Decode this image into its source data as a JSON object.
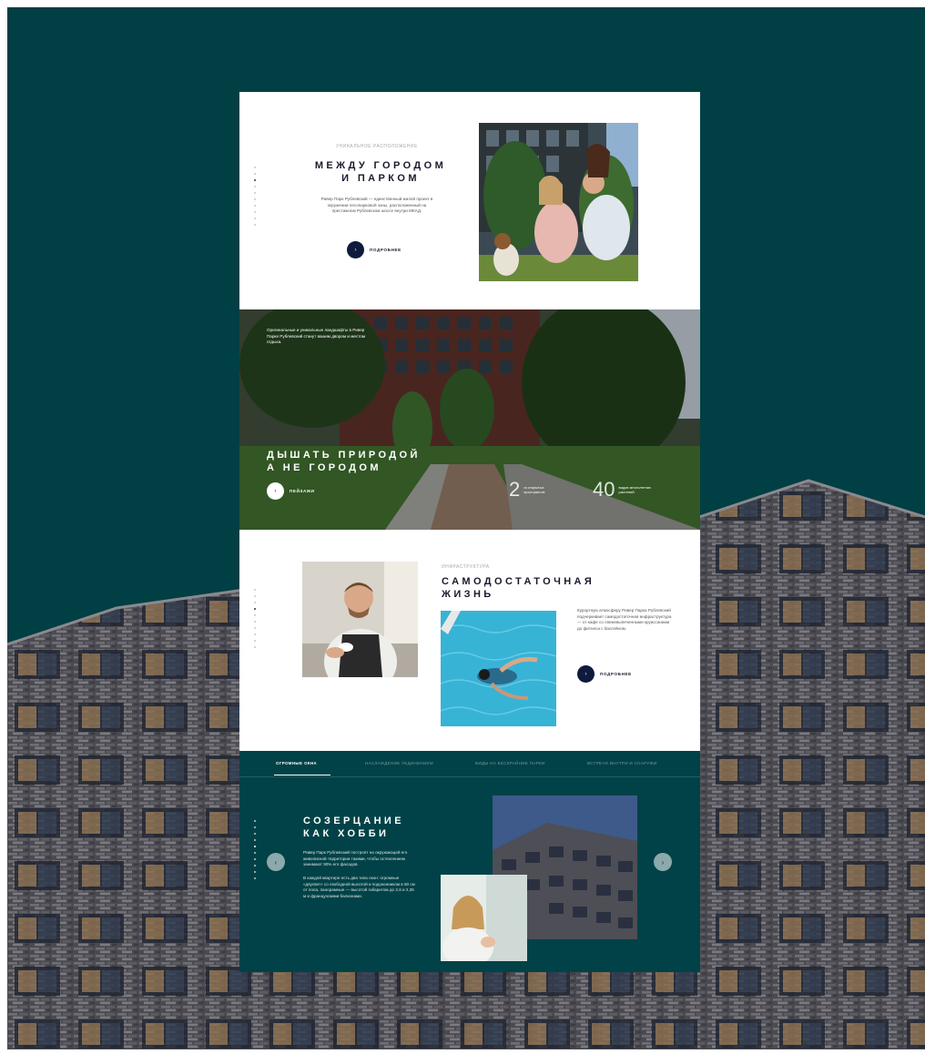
{
  "colors": {
    "teal": "#003f44",
    "navy": "#0f1b3d",
    "white": "#ffffff"
  },
  "section_location": {
    "eyebrow": "УНИКАЛЬНОЕ РАСПОЛОЖЕНИЕ",
    "title": "МЕЖДУ ГОРОДОМ\nИ ПАРКОМ",
    "text": "Ривер Парк Рублевский — единственный жилой проект в окружении лесопарковой зоны, расположенный на престижном Рублевском шоссе внутри МКАД.",
    "more_label": "ПОДРОБНЕЕ"
  },
  "section_nature": {
    "intro": "Оригинальные и уникальные ландшафты в Ривер Парке Рублевский станут вашим двором и местом отдыха.",
    "title": "ДЫШАТЬ ПРИРОДОЙ\nА НЕ ГОРОДОМ",
    "btn_label": "ПЕЙЗАЖИ",
    "stats": [
      {
        "num": "2",
        "label": "га открытых пространств"
      },
      {
        "num": "40",
        "label": "видов многолетних растений"
      }
    ]
  },
  "section_infra": {
    "eyebrow": "ИНФРАСТРУКТУРА",
    "title": "САМОДОСТАТОЧНАЯ\nЖИЗНЬ",
    "text": "Курортную атмосферу Ривер Парка Рублевский подчеркивает самодостаточная инфраструктура — от кафе со свежевыпеченными круассанами до фитнеса с бассейном.",
    "more_label": "ПОДРОБНЕЕ"
  },
  "section_windows": {
    "tabs": [
      "ОГРОМНЫЕ ОКНА",
      "НАСЛАЖДЕНИЕ УЕДИНЕНИЕМ",
      "ВИДЫ НА БЕСКРАЙНИЕ ПАРКИ",
      "ВСТРЕЧИ ВНУТРИ И СНАРУЖИ"
    ],
    "title": "СОЗЕРЦАНИЕ\nКАК ХОББИ",
    "text1": "Ривер Парк Рублевский построят на окружающей его живописной территории такими, чтобы остеклением занимают 90% его фасадов.",
    "text2": "В каждой квартире есть два типа окон: огромные «двусвет» со свободной высотой и подоконником в 60 см от пола, панорамные — высотой габаритом до 2,6 и 2,35 м и французскими балконами."
  }
}
